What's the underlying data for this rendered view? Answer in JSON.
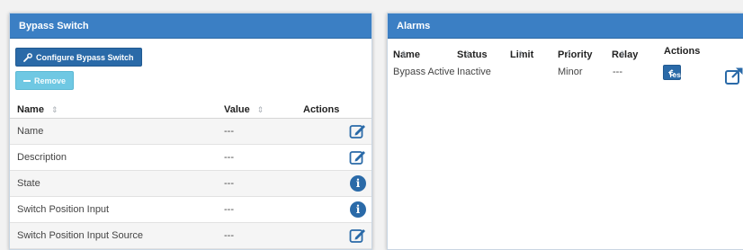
{
  "bypass": {
    "title": "Bypass Switch",
    "configure_label": "Configure Bypass Switch",
    "remove_label": "Remove",
    "columns": {
      "name": "Name",
      "value": "Value",
      "actions": "Actions"
    },
    "rows": [
      {
        "name": "Name",
        "value": "---",
        "action": "edit-icon"
      },
      {
        "name": "Description",
        "value": "---",
        "action": "edit-icon"
      },
      {
        "name": "State",
        "value": "---",
        "action": "info-icon"
      },
      {
        "name": "Switch Position Input",
        "value": "---",
        "action": "info-icon"
      },
      {
        "name": "Switch Position Input Source",
        "value": "---",
        "action": "edit-icon"
      }
    ]
  },
  "alarms": {
    "title": "Alarms",
    "columns": {
      "name": "Name",
      "status": "Status",
      "limit": "Limit",
      "priority": "Priority",
      "relay": "Relay",
      "actions": "Actions"
    },
    "rows": [
      {
        "name": "Bypass Active",
        "status": "Inactive",
        "limit": "",
        "priority": "Minor",
        "relay": "---",
        "test_label": "Test Alarm"
      }
    ]
  },
  "colors": {
    "header": "#3b7fc4",
    "primary_button": "#2a6aa8",
    "info_button": "#6fc8e3"
  }
}
